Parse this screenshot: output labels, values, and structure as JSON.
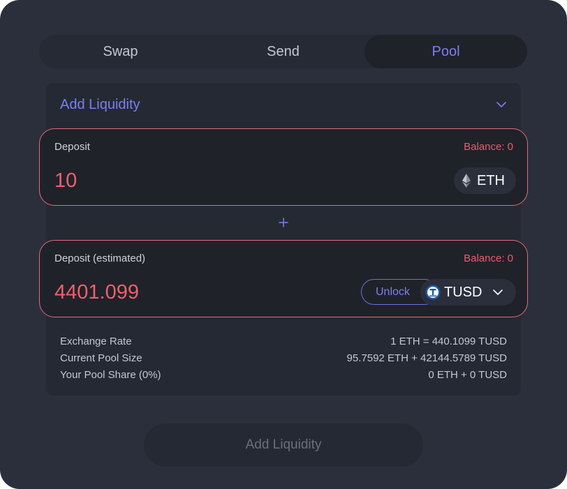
{
  "tabs": [
    {
      "label": "Swap",
      "active": false
    },
    {
      "label": "Send",
      "active": false
    },
    {
      "label": "Pool",
      "active": true
    }
  ],
  "panel": {
    "title": "Add Liquidity"
  },
  "deposit_1": {
    "label": "Deposit",
    "balance": "Balance: 0",
    "amount": "10",
    "token": {
      "symbol": "ETH",
      "icon": "eth-icon"
    }
  },
  "plus_icon": "plus-icon",
  "deposit_2": {
    "label": "Deposit (estimated)",
    "balance": "Balance: 0",
    "amount": "4401.099",
    "unlock_label": "Unlock",
    "token": {
      "symbol": "TUSD",
      "icon": "tusd-icon"
    }
  },
  "stats": [
    {
      "label": "Exchange Rate",
      "value": "1 ETH = 440.1099 TUSD"
    },
    {
      "label": "Current Pool Size",
      "value": "95.7592 ETH + 42144.5789 TUSD"
    },
    {
      "label": "Your Pool Share (0%)",
      "value": "0 ETH + 0 TUSD"
    }
  ],
  "submit_label": "Add Liquidity",
  "colors": {
    "background": "#2b2f3c",
    "accent": "#7b7ff2",
    "error": "#ec5c6c",
    "input_border": "#e26b78"
  }
}
